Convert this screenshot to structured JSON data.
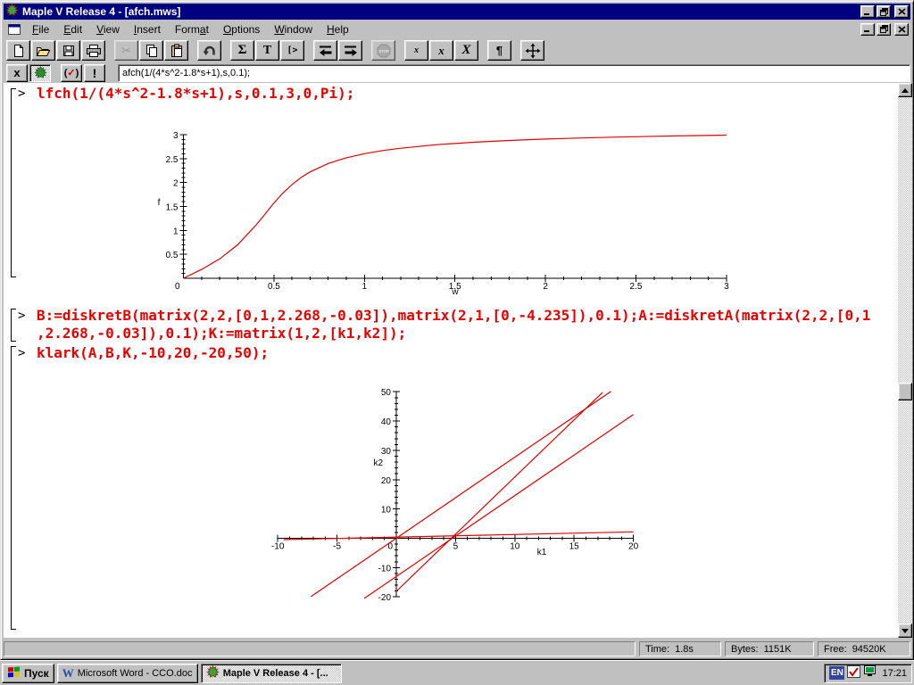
{
  "window": {
    "title": "Maple V Release 4 - [afch.mws]"
  },
  "menu": {
    "items": [
      {
        "label": "File",
        "accel": 0
      },
      {
        "label": "Edit",
        "accel": 0
      },
      {
        "label": "View",
        "accel": 0
      },
      {
        "label": "Insert",
        "accel": 0
      },
      {
        "label": "Format",
        "accel": 4
      },
      {
        "label": "Options",
        "accel": 0
      },
      {
        "label": "Window",
        "accel": 0
      },
      {
        "label": "Help",
        "accel": 0
      }
    ]
  },
  "toolbar": {
    "buttons": [
      {
        "id": "new"
      },
      {
        "id": "open"
      },
      {
        "id": "save"
      },
      {
        "id": "print"
      },
      {
        "id": "cut",
        "disabled": true,
        "gap": true
      },
      {
        "id": "copy"
      },
      {
        "id": "paste"
      },
      {
        "id": "undo",
        "gap": true
      },
      {
        "id": "sum",
        "glyph": "Σ",
        "gap": true
      },
      {
        "id": "text-mode",
        "glyph": "T"
      },
      {
        "id": "maple-input",
        "glyph": "[>"
      },
      {
        "id": "outdent",
        "gap": true
      },
      {
        "id": "indent"
      },
      {
        "id": "stop",
        "disabled": true,
        "gap": true
      },
      {
        "id": "x-small",
        "glyph": "x",
        "gap": true
      },
      {
        "id": "x-medium",
        "glyph": "x"
      },
      {
        "id": "x-large",
        "glyph": "X"
      },
      {
        "id": "paragraph",
        "glyph": "¶",
        "gap": true
      },
      {
        "id": "expand",
        "gap": true
      }
    ]
  },
  "context_bar": {
    "buttons": [
      {
        "id": "math-x",
        "glyph": "x"
      },
      {
        "id": "maple-leaf",
        "pressed": true
      },
      {
        "id": "check-syntax",
        "glyph": "(✓)",
        "gap": true
      },
      {
        "id": "interrupt",
        "glyph": "!"
      }
    ],
    "input_value": "afch(1/(4*s^2-1.8*s+1),s,0.1);"
  },
  "worksheet": {
    "groups": [
      {
        "prompt": ">",
        "lines": [
          "lfch(1/(4*s^2-1.8*s+1),s,0.1,3,0,Pi);"
        ]
      },
      {
        "prompt": ">",
        "lines": [
          "B:=diskretB(matrix(2,2,[0,1,2.268,-0.03]),matrix(2,1,[0,-4.235]),0.1);A:=diskretA(matrix(2,2,[0,1",
          ",2.268,-0.03]),0.1);K:=matrix(1,2,[k1,k2]);"
        ]
      },
      {
        "prompt": ">",
        "lines": [
          "klark(A,B,K,-10,20,-20,50);"
        ]
      }
    ]
  },
  "chart_data": [
    {
      "type": "line",
      "title": "",
      "xlabel": "w",
      "ylabel": "f",
      "xlim": [
        0,
        3
      ],
      "ylim": [
        0,
        3
      ],
      "x_major": 0.5,
      "x_minor": 0.1,
      "y_major": 0.5,
      "y_minor": 0.1,
      "origin_label": "0",
      "grid": false,
      "line_color": "#e00000",
      "series": [
        {
          "name": "lfch-curve",
          "points": [
            [
              0,
              0
            ],
            [
              0.1,
              0.185
            ],
            [
              0.2,
              0.405
            ],
            [
              0.3,
              0.7
            ],
            [
              0.4,
              1.107
            ],
            [
              0.45,
              1.336
            ],
            [
              0.5,
              1.571
            ],
            [
              0.55,
              1.78
            ],
            [
              0.6,
              1.958
            ],
            [
              0.65,
              2.104
            ],
            [
              0.7,
              2.222
            ],
            [
              0.8,
              2.397
            ],
            [
              0.9,
              2.516
            ],
            [
              1,
              2.601
            ],
            [
              1.1,
              2.666
            ],
            [
              1.2,
              2.716
            ],
            [
              1.4,
              2.789
            ],
            [
              1.6,
              2.84
            ],
            [
              1.8,
              2.877
            ],
            [
              2,
              2.906
            ],
            [
              2.2,
              2.929
            ],
            [
              2.4,
              2.948
            ],
            [
              2.6,
              2.964
            ],
            [
              2.8,
              2.977
            ],
            [
              3,
              2.988
            ]
          ]
        }
      ]
    },
    {
      "type": "line",
      "title": "",
      "xlabel": "k1",
      "ylabel": "k2",
      "xlim": [
        -10,
        20
      ],
      "ylim": [
        -20,
        50
      ],
      "x_major": 5,
      "x_minor": 1,
      "y_major": 10,
      "y_minor": 2,
      "origin_label": "0",
      "grid": false,
      "line_color": "#e00000",
      "series": [
        {
          "name": "line-flat",
          "points": [
            [
              -9.5,
              -0.45
            ],
            [
              20,
              2.2
            ]
          ]
        },
        {
          "name": "line-origin",
          "points": [
            [
              -7.2,
              -19.9
            ],
            [
              18.1,
              50.1
            ]
          ]
        },
        {
          "name": "line-lower",
          "points": [
            [
              -2.7,
              -20.5
            ],
            [
              20,
              42.2
            ]
          ]
        },
        {
          "name": "line-steep",
          "points": [
            [
              0,
              -18.1
            ],
            [
              17.4,
              49.8
            ]
          ]
        }
      ]
    }
  ],
  "status_bar": {
    "time_label": "Time:",
    "time_value": "1.8s",
    "bytes_label": "Bytes:",
    "bytes_value": "1151K",
    "free_label": "Free:",
    "free_value": "94520K"
  },
  "taskbar": {
    "start_label": "Пуск",
    "tasks": [
      {
        "label": "Microsoft Word - CCO.doc",
        "active": false
      },
      {
        "label": "Maple V Release 4 - [...",
        "active": true
      }
    ],
    "tray": {
      "lang": "EN",
      "clock": "17:21"
    }
  }
}
